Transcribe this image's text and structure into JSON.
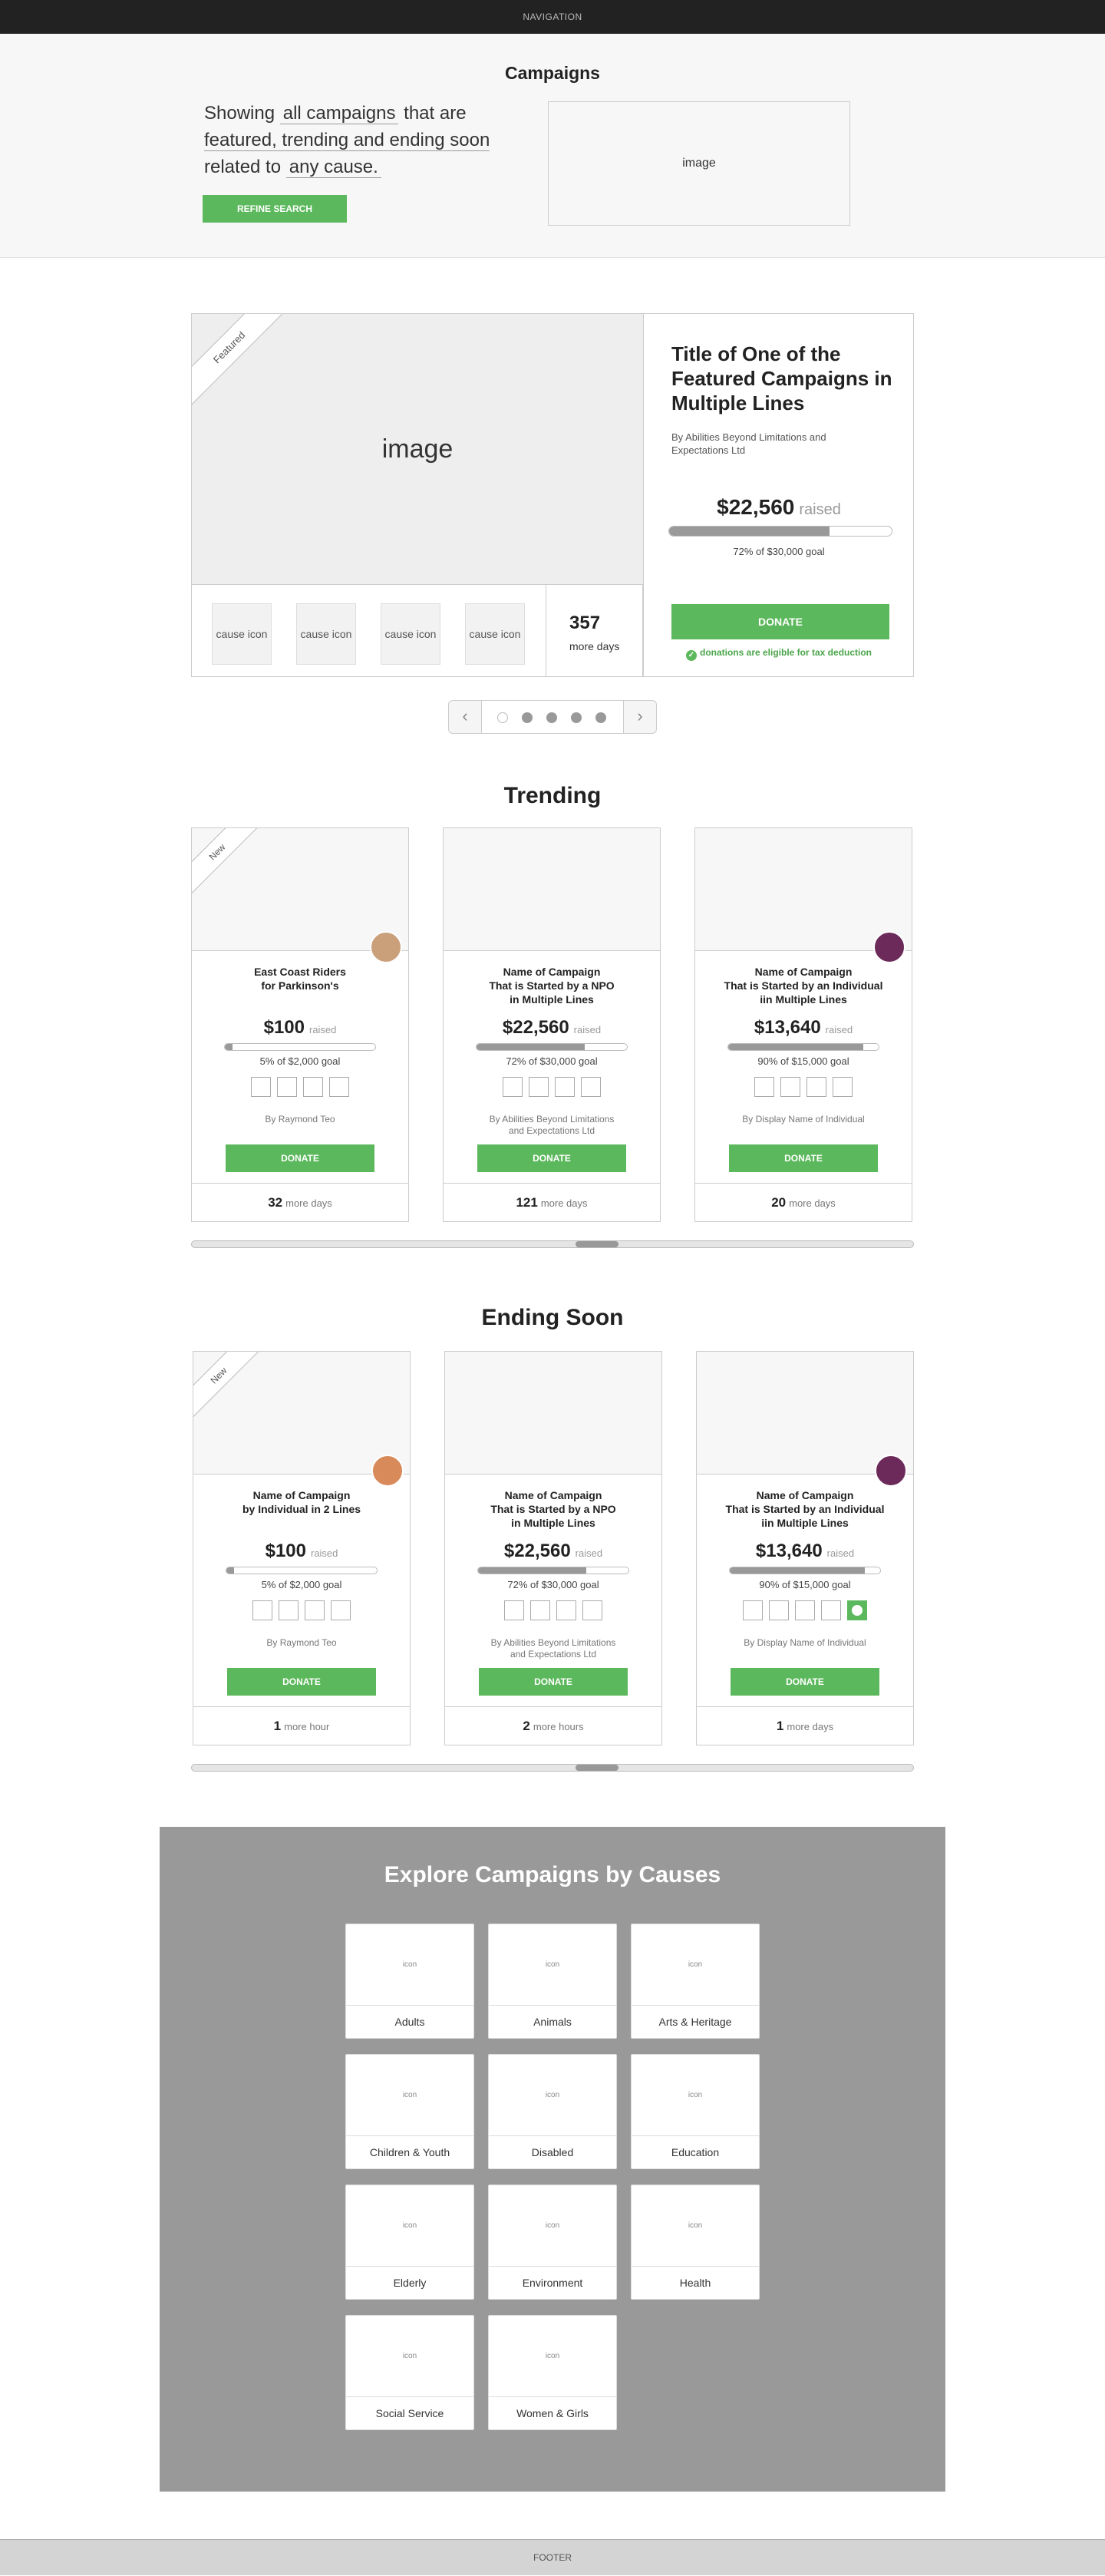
{
  "nav": {
    "label": "NAVIGATION"
  },
  "hero": {
    "title": "Campaigns",
    "sentence": {
      "showing": "Showing",
      "campaigns_option": "all campaigns",
      "that_are": "that are",
      "status_option": "featured, trending and ending soon",
      "related_to": "related to",
      "cause_option": "any cause."
    },
    "refine_label": "REFINE SEARCH",
    "image_label": "image"
  },
  "featured": {
    "ribbon": "Featured",
    "image_label": "image",
    "cause_icons": [
      "cause icon",
      "cause icon",
      "cause icon",
      "cause icon"
    ],
    "days_number": "357",
    "days_label": "more days",
    "title": "Title of One of the Featured Campaigns in Multiple Lines",
    "by": "By Abilities Beyond Limitations and Expectations Ltd",
    "amount": "$22,560",
    "raised_label": "raised",
    "progress": 0.72,
    "goal_text": "72% of $30,000 goal",
    "donate_label": "DONATE",
    "tax_note": "donations are eligible for tax deduction"
  },
  "pager": {
    "prev": "‹",
    "next": "›",
    "dot_count": 5,
    "active_index": 0
  },
  "trending": {
    "title": "Trending",
    "cards": [
      {
        "ribbon": "New",
        "title": "East Coast Riders\nfor Parkinson's",
        "amount": "$100",
        "raised_label": "raised",
        "progress": 0.05,
        "goal_text": "5% of $2,000 goal",
        "by": "By Raymond Teo",
        "donate_label": "DONATE",
        "days_number": "32",
        "days_label": "more days",
        "avatar_color": "#c9a07a",
        "badges_checked": [
          false,
          false,
          false,
          false
        ]
      },
      {
        "ribbon": "",
        "title": "Name of Campaign\nThat is Started by a NPO\nin Multiple Lines",
        "amount": "$22,560",
        "raised_label": "raised",
        "progress": 0.72,
        "goal_text": "72% of $30,000 goal",
        "by": "By Abilities Beyond Limitations\nand Expectations Ltd",
        "donate_label": "DONATE",
        "days_number": "121",
        "days_label": "more days",
        "avatar_color": "",
        "badges_checked": [
          false,
          false,
          false,
          false
        ]
      },
      {
        "ribbon": "",
        "title": "Name of Campaign\nThat is Started by an Individual\niin Multiple Lines",
        "amount": "$13,640",
        "raised_label": "raised",
        "progress": 0.9,
        "goal_text": "90% of $15,000 goal",
        "by": "By  Display Name of Individual",
        "donate_label": "DONATE",
        "days_number": "20",
        "days_label": "more days",
        "avatar_color": "#6b2a5a",
        "badges_checked": [
          false,
          false,
          false,
          false
        ]
      }
    ]
  },
  "ending": {
    "title": "Ending Soon",
    "cards": [
      {
        "ribbon": "New",
        "title": "Name of Campaign\nby Individual in 2 Lines",
        "amount": "$100",
        "raised_label": "raised",
        "progress": 0.05,
        "goal_text": "5% of $2,000 goal",
        "by": "By Raymond Teo",
        "donate_label": "DONATE",
        "days_number": "1",
        "days_label": "more hour",
        "avatar_color": "#d98a5a",
        "badges_checked": [
          false,
          false,
          false,
          false
        ]
      },
      {
        "ribbon": "",
        "title": "Name of Campaign\nThat is Started by a NPO\nin Multiple Lines",
        "amount": "$22,560",
        "raised_label": "raised",
        "progress": 0.72,
        "goal_text": "72% of $30,000 goal",
        "by": "By Abilities Beyond Limitations\nand Expectations Ltd",
        "donate_label": "DONATE",
        "days_number": "2",
        "days_label": "more hours",
        "avatar_color": "",
        "badges_checked": [
          false,
          false,
          false,
          false
        ]
      },
      {
        "ribbon": "",
        "title": "Name of Campaign\nThat is Started by an Individual\niin Multiple Lines",
        "amount": "$13,640",
        "raised_label": "raised",
        "progress": 0.9,
        "goal_text": "90% of $15,000 goal",
        "by": "By  Display Name of Individual",
        "donate_label": "DONATE",
        "days_number": "1",
        "days_label": "more days",
        "avatar_color": "#6b2a5a",
        "badges_checked": [
          false,
          false,
          false,
          false,
          true
        ]
      }
    ]
  },
  "causes": {
    "title": "Explore Campaigns by Causes",
    "icon_label": "icon",
    "items": [
      "Adults",
      "Animals",
      "Arts & Heritage",
      "Children & Youth",
      "Disabled",
      "Education",
      "Elderly",
      "Environment",
      "Health",
      "Social Service",
      "Women & Girls"
    ]
  },
  "footer": {
    "label": "FOOTER"
  },
  "colors": {
    "accent": "#5cb85c",
    "dark": "#222222",
    "panel": "#999999"
  }
}
